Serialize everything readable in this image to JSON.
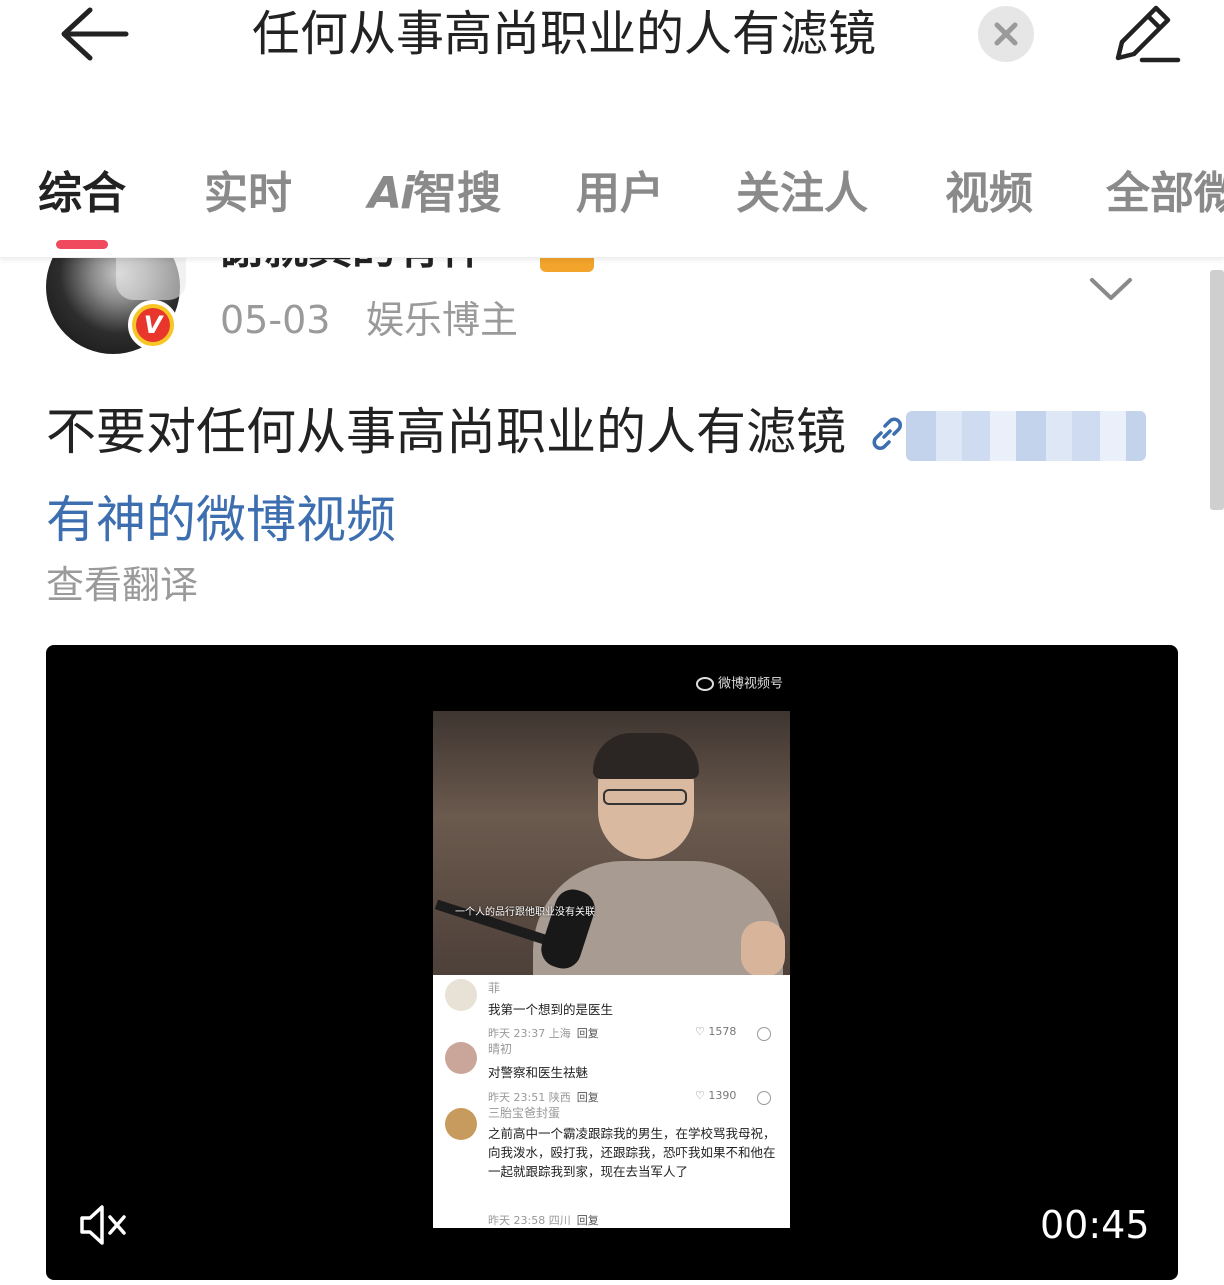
{
  "search": {
    "query": "任何从事高尚职业的人有滤镜",
    "back_icon": "arrow-left-icon",
    "clear_icon": "close-icon",
    "edit_icon": "pencil-icon"
  },
  "tabs": [
    {
      "label": "综合",
      "active": true
    },
    {
      "label": "实时",
      "active": false
    },
    {
      "label": "智搜",
      "prefix": "Ai",
      "active": false
    },
    {
      "label": "用户",
      "active": false
    },
    {
      "label": "关注人",
      "active": false
    },
    {
      "label": "视频",
      "active": false
    },
    {
      "label": "全部微",
      "active": false
    }
  ],
  "colors": {
    "accent": "#ef4a5d",
    "link": "#3d6fb0",
    "muted": "#9a9a9a"
  },
  "post": {
    "author": "謝就真的有神",
    "date": "05-03",
    "role": "娱乐博主",
    "text": "不要对任何从事高尚职业的人有滤镜",
    "link_text": "有神的微博视频",
    "translate": "查看翻译",
    "video": {
      "watermark": "微博视频号",
      "subtitle": "一个人的品行跟他职业没有关联",
      "duration": "00:45",
      "comments": [
        {
          "name": "菲",
          "text": "我第一个想到的是医生",
          "time": "昨天 23:37 上海",
          "reply": "回复",
          "likes": "1578"
        },
        {
          "name": "晴初",
          "text": "对警察和医生祛魅",
          "time": "昨天 23:51 陕西",
          "reply": "回复",
          "likes": "1390"
        },
        {
          "name": "三胎宝爸封蛋",
          "text": "之前高中一个霸凌跟踪我的男生，在学校骂我母祝，向我泼水，殴打我，还跟踪我，恐吓我如果不和他在一起就跟踪我到家，现在去当军人了",
          "time": "昨天 23:58 四川",
          "reply": "回复",
          "likes": ""
        }
      ]
    }
  }
}
